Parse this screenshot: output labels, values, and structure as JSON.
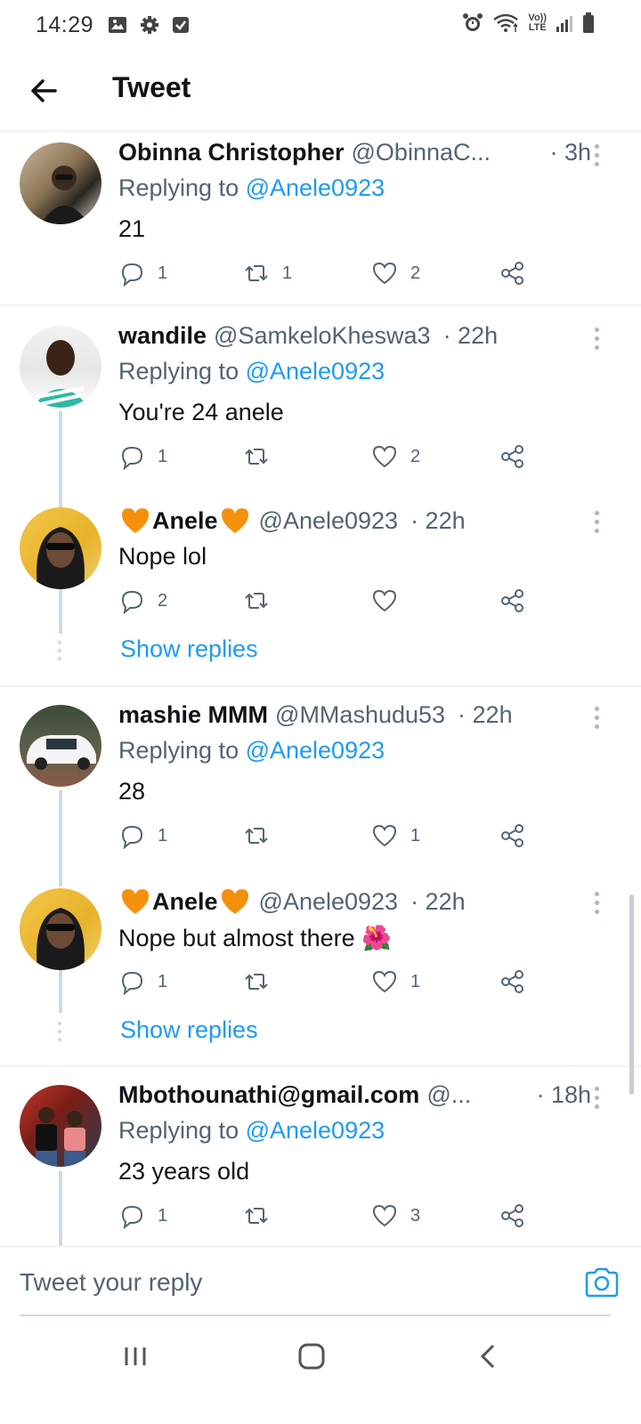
{
  "status_bar": {
    "time": "14:29",
    "left_icons": [
      "gallery-icon",
      "gear-icon",
      "check-box-icon"
    ],
    "right_icons": [
      "alarm-icon",
      "wifi-icon",
      "volte-icon",
      "signal-icon",
      "battery-icon"
    ],
    "volte_top": "Vo))",
    "volte_bottom": "LTE"
  },
  "header": {
    "title": "Tweet",
    "back_icon": "arrow-left-icon"
  },
  "tweets": [
    {
      "name": "Obinna Christopher",
      "handle": "@ObinnaC...",
      "time": "· 3h",
      "replying_prefix": "Replying to ",
      "replying_to": "@Anele0923",
      "text": "21",
      "replies": "1",
      "retweets": "1",
      "likes": "2"
    },
    {
      "name": "wandile",
      "handle": "@SamkeloKheswa3",
      "time": "· 22h",
      "replying_prefix": "Replying to ",
      "replying_to": "@Anele0923",
      "text": "You're 24 anele",
      "replies": "1",
      "retweets": "",
      "likes": "2"
    },
    {
      "name": "Anele",
      "handle": "@Anele0923",
      "time": "· 22h",
      "text": "Nope lol",
      "replies": "2",
      "retweets": "",
      "likes": "",
      "show_replies": "Show replies"
    },
    {
      "name": "mashie MMM",
      "handle": "@MMashudu53",
      "time": "· 22h",
      "replying_prefix": "Replying to ",
      "replying_to": "@Anele0923",
      "text": "28",
      "replies": "1",
      "retweets": "",
      "likes": "1"
    },
    {
      "name": "Anele",
      "handle": "@Anele0923",
      "time": "· 22h",
      "text": "Nope but almost there",
      "emoji": "🌺",
      "replies": "1",
      "retweets": "",
      "likes": "1",
      "show_replies": "Show replies"
    },
    {
      "name": "Mbothounathi@gmail.com",
      "handle": "@...",
      "time": "· 18h",
      "replying_prefix": "Replying to ",
      "replying_to": "@Anele0923",
      "text": "23 years old",
      "replies": "1",
      "retweets": "",
      "likes": "3"
    }
  ],
  "compose": {
    "placeholder": "Tweet your reply",
    "camera_icon": "camera-icon"
  },
  "nav_bar": {
    "items": [
      "recent-apps-icon",
      "home-icon",
      "back-icon"
    ]
  },
  "colors": {
    "link": "#1d9bf0",
    "muted": "#536471",
    "text": "#0f1419",
    "heart_emoji": "#f5900c"
  }
}
